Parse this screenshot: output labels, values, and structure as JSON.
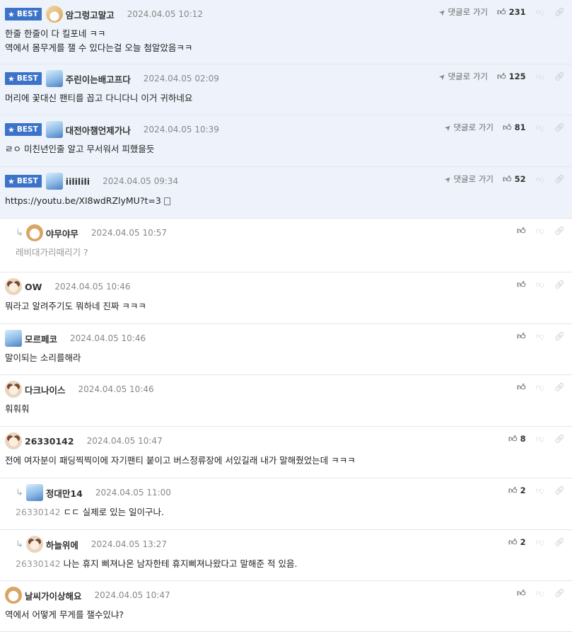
{
  "ui": {
    "best_label": "BEST",
    "goto_label": "댓글로 가기"
  },
  "comments": [
    {
      "best": true,
      "reply": false,
      "avatar": "fox",
      "nick": "암그렁고말고",
      "date": "2024.04.05 10:12",
      "likes": "231",
      "lines": [
        "한줄 한줄이 다 킬포네 ㅋㅋ",
        "역에서 몸무게를 잴 수 있다는걸 오늘 첨알았음ㅋㅋ"
      ]
    },
    {
      "best": true,
      "reply": false,
      "avatar": "ice",
      "nick": "주린이는배고프다",
      "date": "2024.04.05 02:09",
      "likes": "125",
      "lines": [
        "머리에 꽃대신 팬티를 꼽고 다니다니 이거 귀하네요"
      ]
    },
    {
      "best": true,
      "reply": false,
      "avatar": "ice",
      "nick": "대전아챔언제가나",
      "date": "2024.04.05 10:39",
      "likes": "81",
      "lines": [
        "ㄹㅇ 미친년인줄 알고 무서워서 피했을듯"
      ]
    },
    {
      "best": true,
      "reply": false,
      "avatar": "ice",
      "nick": "iililili",
      "date": "2024.04.05 09:34",
      "likes": "52",
      "lines": [
        "https://youtu.be/XI8wdRZlyMU?t=3"
      ],
      "link": true
    },
    {
      "best": false,
      "reply": true,
      "avatar": "pup",
      "nick": "야무야무",
      "date": "2024.04.05 10:57",
      "likes": "",
      "lines": [
        "레비대가리때리기 ?"
      ],
      "grey_body": true
    },
    {
      "best": false,
      "reply": false,
      "avatar": "dog",
      "nick": "OW",
      "date": "2024.04.05 10:46",
      "likes": "",
      "lines": [
        "뭐라고 알려주기도 뭐하네 진짜 ㅋㅋㅋ"
      ]
    },
    {
      "best": false,
      "reply": false,
      "avatar": "ice",
      "nick": "모르페코",
      "date": "2024.04.05 10:46",
      "likes": "",
      "lines": [
        "말이되는 소리를해라"
      ]
    },
    {
      "best": false,
      "reply": false,
      "avatar": "dog",
      "nick": "다크나이스",
      "date": "2024.04.05 10:46",
      "likes": "",
      "lines": [
        "훠훠훠"
      ]
    },
    {
      "best": false,
      "reply": false,
      "avatar": "dog",
      "nick": "26330142",
      "date": "2024.04.05 10:47",
      "likes": "8",
      "lines": [
        "전에 여자분이 패딩찍찍이에 자기팬티 붙이고 버스정류장에 서있길래 내가 말해줬었는데 ㅋㅋㅋ"
      ]
    },
    {
      "best": false,
      "reply": true,
      "avatar": "ice",
      "nick": "정대만14",
      "date": "2024.04.05 11:00",
      "likes": "2",
      "mention": "26330142",
      "lines": [
        "ㄷㄷ 실제로 있는 일이구나."
      ]
    },
    {
      "best": false,
      "reply": true,
      "avatar": "dog",
      "nick": "하늘위에",
      "date": "2024.04.05 13:27",
      "likes": "2",
      "mention": "26330142",
      "lines": [
        "나는 휴지 삐져나온 남자한테 휴지삐져나왔다고 말해준 적 있음."
      ]
    },
    {
      "best": false,
      "reply": false,
      "avatar": "pup",
      "nick": "날씨가이상해요",
      "date": "2024.04.05 10:47",
      "likes": "",
      "lines": [
        "역에서 어떻게 무게를 잴수있냐?"
      ]
    }
  ]
}
